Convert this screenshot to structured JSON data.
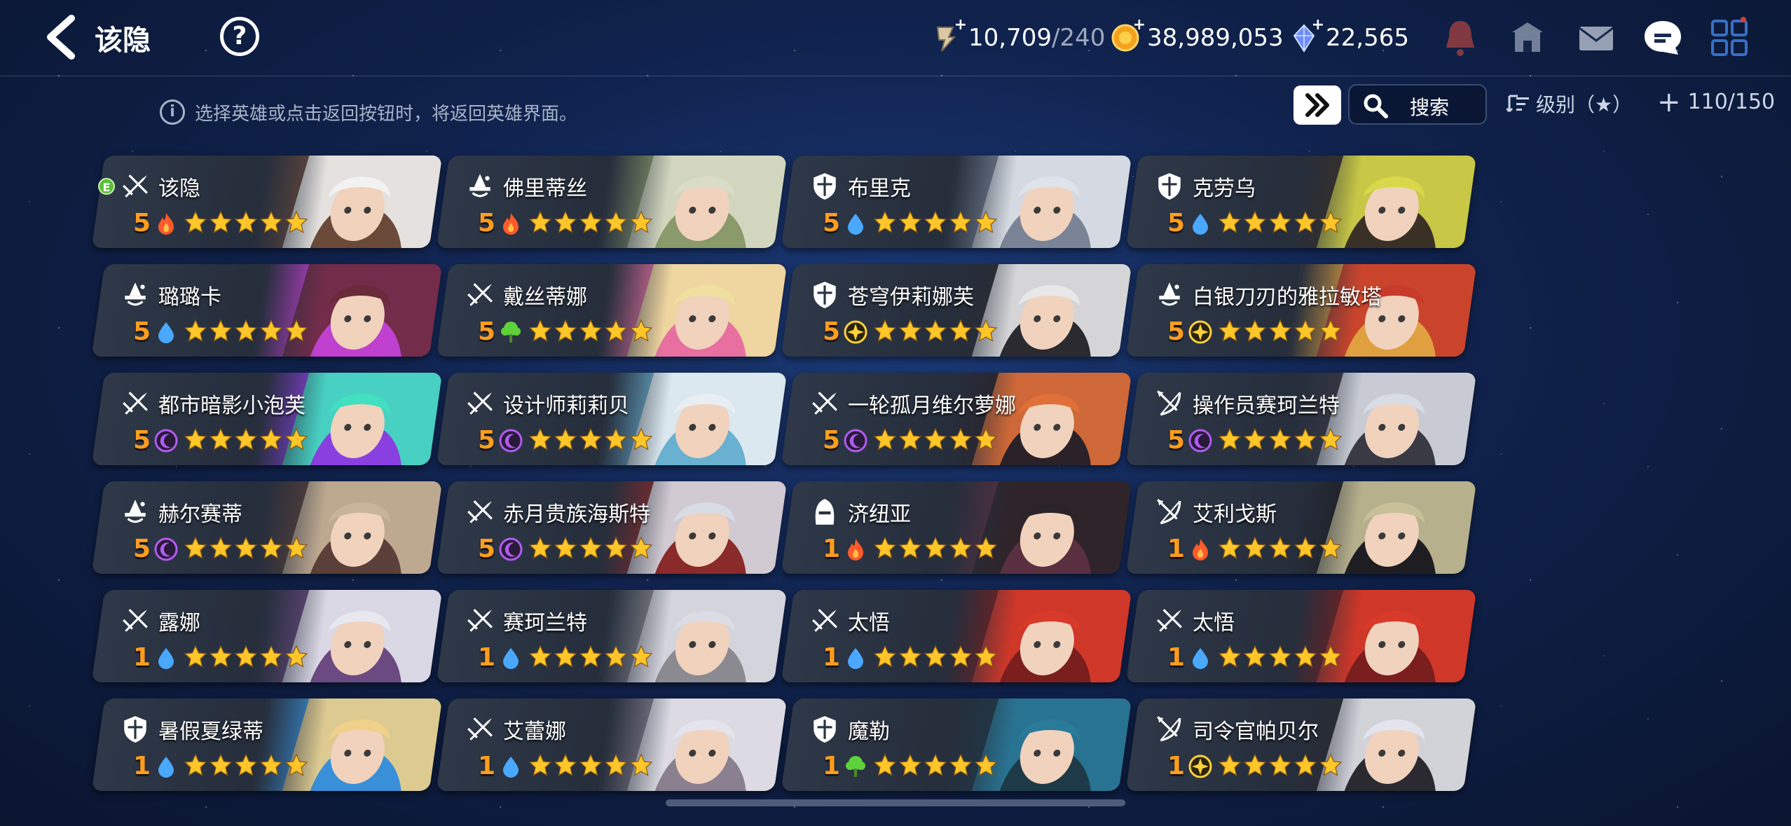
{
  "header": {
    "title": "该隐",
    "currencies": [
      {
        "name": "stamina",
        "icon": "stamina-icon",
        "value": "10,709",
        "max": "/240"
      },
      {
        "name": "gold",
        "icon": "gold-coin-icon",
        "value": "38,989,053",
        "max": ""
      },
      {
        "name": "crystal",
        "icon": "crystal-icon",
        "value": "22,565",
        "max": ""
      }
    ]
  },
  "toolbar": {
    "hint": "选择英雄或点击返回按钮时，将返回英雄界面。",
    "search_label": "搜索",
    "sort_label": "级别（★）",
    "hero_count": "110/150"
  },
  "colors": {
    "level": "#ff9d1e",
    "star": "#ffc629",
    "water": "#4aa8ff",
    "fire": "#ff5a2a",
    "earth": "#5ed23a",
    "dark": "#b05cf0",
    "light": "#ffd23a"
  },
  "heroes": [
    {
      "name": "该隐",
      "class": "warrior",
      "level": "5",
      "element": "fire",
      "stars": 5,
      "equipped": "E",
      "palette": [
        "#f2f2f2",
        "#6b4a3a"
      ]
    },
    {
      "name": "佛里蒂丝",
      "class": "mage",
      "level": "5",
      "element": "fire",
      "stars": 5,
      "palette": [
        "#d9ddc8",
        "#8a9a6a"
      ]
    },
    {
      "name": "布里克",
      "class": "knight",
      "level": "5",
      "element": "water",
      "stars": 5,
      "palette": [
        "#dfe3ea",
        "#7a8496"
      ]
    },
    {
      "name": "克劳乌",
      "class": "knight",
      "level": "5",
      "element": "water",
      "stars": 5,
      "palette": [
        "#d8d84a",
        "#3a3026"
      ]
    },
    {
      "name": "璐璐卡",
      "class": "mage",
      "level": "5",
      "element": "water",
      "stars": 5,
      "palette": [
        "#6a2a3a",
        "#c040d0"
      ]
    },
    {
      "name": "戴丝蒂娜",
      "class": "warrior",
      "level": "5",
      "element": "earth",
      "stars": 5,
      "palette": [
        "#f0e0a0",
        "#e870a0"
      ]
    },
    {
      "name": "苍穹伊莉娜芙",
      "class": "knight",
      "level": "5",
      "element": "light",
      "stars": 5,
      "palette": [
        "#e8e8ea",
        "#2a2a30"
      ]
    },
    {
      "name": "白银刀刃的雅拉敏塔",
      "class": "mage",
      "level": "5",
      "element": "light",
      "stars": 5,
      "palette": [
        "#c83a2a",
        "#e0a040"
      ]
    },
    {
      "name": "都市暗影小泡芙",
      "class": "warrior",
      "level": "5",
      "element": "dark",
      "stars": 5,
      "palette": [
        "#40e0c0",
        "#8a40e0"
      ]
    },
    {
      "name": "设计师莉莉贝",
      "class": "warrior",
      "level": "5",
      "element": "dark",
      "stars": 5,
      "palette": [
        "#e8eef2",
        "#6ab0d0"
      ]
    },
    {
      "name": "一轮孤月维尔萝娜",
      "class": "warrior",
      "level": "5",
      "element": "dark",
      "stars": 5,
      "palette": [
        "#e0703a",
        "#2a2228"
      ]
    },
    {
      "name": "操作员赛珂兰特",
      "class": "archer",
      "level": "5",
      "element": "dark",
      "stars": 5,
      "palette": [
        "#d8dce4",
        "#3a3a44"
      ]
    },
    {
      "name": "赫尔赛蒂",
      "class": "mage",
      "level": "5",
      "element": "dark",
      "stars": 5,
      "palette": [
        "#c8b49a",
        "#5a4038"
      ]
    },
    {
      "name": "赤月贵族海斯特",
      "class": "warrior",
      "level": "5",
      "element": "dark",
      "stars": 5,
      "palette": [
        "#d8dce4",
        "#8a2a2a"
      ]
    },
    {
      "name": "济纽亚",
      "class": "assassin",
      "level": "1",
      "element": "fire",
      "stars": 5,
      "palette": [
        "#2a2428",
        "#5a3040"
      ]
    },
    {
      "name": "艾利戈斯",
      "class": "archer",
      "level": "1",
      "element": "fire",
      "stars": 5,
      "palette": [
        "#c8c098",
        "#1e1e22"
      ]
    },
    {
      "name": "露娜",
      "class": "warrior",
      "level": "1",
      "element": "water",
      "stars": 5,
      "palette": [
        "#e8e8f0",
        "#6a4a80"
      ]
    },
    {
      "name": "赛珂兰特",
      "class": "warrior",
      "level": "1",
      "element": "water",
      "stars": 5,
      "palette": [
        "#dcdce4",
        "#8a8a90"
      ]
    },
    {
      "name": "太悟",
      "class": "warrior",
      "level": "1",
      "element": "water",
      "stars": 5,
      "palette": [
        "#d83a2a",
        "#7a1e1e"
      ]
    },
    {
      "name": "太悟",
      "class": "warrior",
      "level": "1",
      "element": "water",
      "stars": 5,
      "palette": [
        "#d83a2a",
        "#7a1e1e"
      ]
    },
    {
      "name": "暑假夏绿蒂",
      "class": "knight",
      "level": "1",
      "element": "water",
      "stars": 5,
      "palette": [
        "#f0d08a",
        "#3a90d8"
      ]
    },
    {
      "name": "艾蕾娜",
      "class": "warrior",
      "level": "1",
      "element": "water",
      "stars": 5,
      "palette": [
        "#e4e4ec",
        "#8a8090"
      ]
    },
    {
      "name": "魔勒",
      "class": "knight",
      "level": "1",
      "element": "earth",
      "stars": 5,
      "palette": [
        "#2a7a9a",
        "#1e3a48"
      ]
    },
    {
      "name": "司令官帕贝尔",
      "class": "archer",
      "level": "1",
      "element": "light",
      "stars": 5,
      "palette": [
        "#e4e4ec",
        "#2a2a30"
      ]
    }
  ]
}
